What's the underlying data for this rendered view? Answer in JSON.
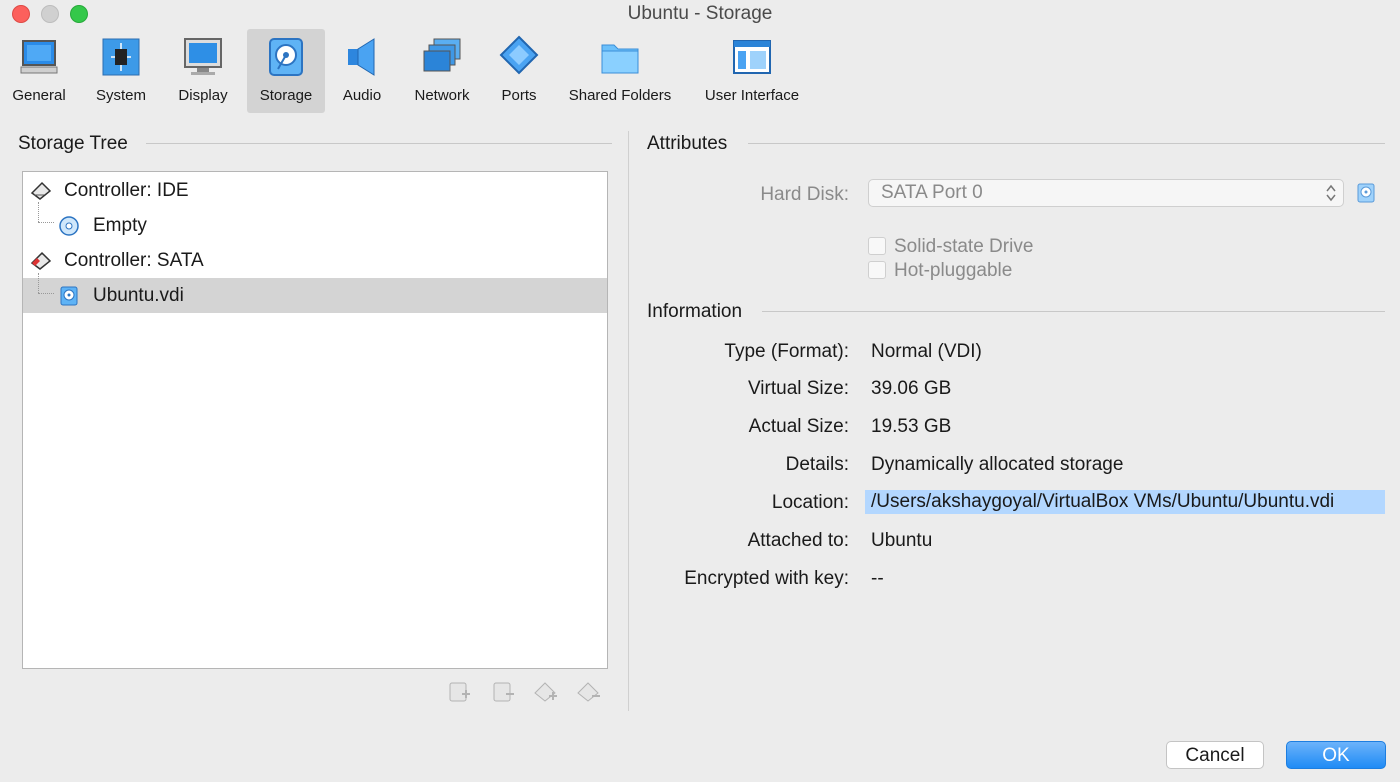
{
  "window": {
    "title": "Ubuntu - Storage"
  },
  "toolbar": {
    "items": [
      {
        "label": "General",
        "icon": "general-icon"
      },
      {
        "label": "System",
        "icon": "system-chip-icon"
      },
      {
        "label": "Display",
        "icon": "display-monitor-icon"
      },
      {
        "label": "Storage",
        "icon": "storage-disk-icon",
        "active": true
      },
      {
        "label": "Audio",
        "icon": "audio-speaker-icon"
      },
      {
        "label": "Network",
        "icon": "network-icon"
      },
      {
        "label": "Ports",
        "icon": "ports-icon"
      },
      {
        "label": "Shared Folders",
        "icon": "folder-icon"
      },
      {
        "label": "User Interface",
        "icon": "user-interface-icon"
      }
    ]
  },
  "storage_tree": {
    "title": "Storage Tree",
    "rows": [
      {
        "label": "Controller: IDE",
        "icon": "ide-controller-icon"
      },
      {
        "label": "Empty",
        "icon": "optical-disc-icon"
      },
      {
        "label": "Controller: SATA",
        "icon": "sata-controller-icon"
      },
      {
        "label": "Ubuntu.vdi",
        "icon": "hard-disk-icon",
        "selected": true
      }
    ]
  },
  "attributes": {
    "title": "Attributes",
    "hard_disk_label": "Hard Disk:",
    "hard_disk_value": "SATA Port 0",
    "solid_state_label": "Solid-state Drive",
    "hot_pluggable_label": "Hot-pluggable"
  },
  "information": {
    "title": "Information",
    "type_label": "Type (Format):",
    "type_value": "Normal (VDI)",
    "virtual_size_label": "Virtual Size:",
    "virtual_size_value": "39.06 GB",
    "actual_size_label": "Actual Size:",
    "actual_size_value": "19.53 GB",
    "details_label": "Details:",
    "details_value": "Dynamically allocated storage",
    "location_label": "Location:",
    "location_value": "/Users/akshaygoyal/VirtualBox VMs/Ubuntu/Ubuntu.vdi",
    "attached_label": "Attached to:",
    "attached_value": "Ubuntu",
    "encrypted_label": "Encrypted with key:",
    "encrypted_value": "--"
  },
  "buttons": {
    "cancel": "Cancel",
    "ok": "OK"
  },
  "colors": {
    "accent": "#1f8bf5",
    "selection": "#b3d7ff"
  }
}
